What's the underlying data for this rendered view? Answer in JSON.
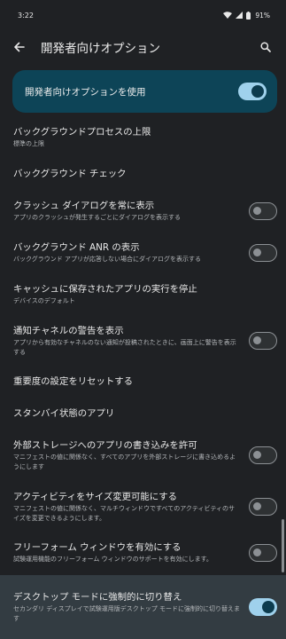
{
  "status": {
    "time": "3:22",
    "battery": "91%"
  },
  "appbar": {
    "title": "開発者向けオプション"
  },
  "master_switch": {
    "label": "開発者向けオプションを使用",
    "on": true
  },
  "items": [
    {
      "title": "バックグラウンドプロセスの上限",
      "subtitle": "標準の上限",
      "toggle": null
    },
    {
      "title": "バックグラウンド チェック",
      "subtitle": "",
      "toggle": null
    },
    {
      "title": "クラッシュ ダイアログを常に表示",
      "subtitle": "アプリのクラッシュが発生するごとにダイアログを表示する",
      "toggle": "off"
    },
    {
      "title": "バックグラウンド ANR の表示",
      "subtitle": "バックグラウンド アプリが応答しない場合にダイアログを表示する",
      "toggle": "off"
    },
    {
      "title": "キャッシュに保存されたアプリの実行を停止",
      "subtitle": "デバイスのデフォルト",
      "toggle": null
    },
    {
      "title": "通知チャネルの警告を表示",
      "subtitle": "アプリから有効なチャネルのない通知が投稿されたときに、画面上に警告を表示する",
      "toggle": "off"
    },
    {
      "title": "重要度の設定をリセットする",
      "subtitle": "",
      "toggle": null
    },
    {
      "title": "スタンバイ状態のアプリ",
      "subtitle": "",
      "toggle": null
    },
    {
      "title": "外部ストレージへのアプリの書き込みを許可",
      "subtitle": "マニフェストの値に関係なく、すべてのアプリを外部ストレージに書き込めるようにします",
      "toggle": "off"
    },
    {
      "title": "アクティビティをサイズ変更可能にする",
      "subtitle": "マニフェストの値に関係なく、マルチウィンドウですべてのアクティビティのサイズを変更できるようにします。",
      "toggle": "off"
    },
    {
      "title": "フリーフォーム ウィンドウを有効にする",
      "subtitle": "試験運用機能のフリーフォーム ウィンドウのサポートを有効にします。",
      "toggle": "off"
    },
    {
      "title": "デスクトップ モードに強制的に切り替え",
      "subtitle": "セカンダリ ディスプレイで試験運用版デスクトップ モードに強制的に切り替えます",
      "toggle": "on",
      "highlight": true
    }
  ],
  "icons": {
    "back": "arrow-left-icon",
    "search": "search-icon",
    "wifi": "wifi-icon",
    "signal": "signal-icon",
    "battery": "battery-icon"
  },
  "colors": {
    "background": "#1f2124",
    "accent": "#9fd1ec",
    "master_bg": "#0d4457",
    "highlight_bg": "#333c42"
  }
}
